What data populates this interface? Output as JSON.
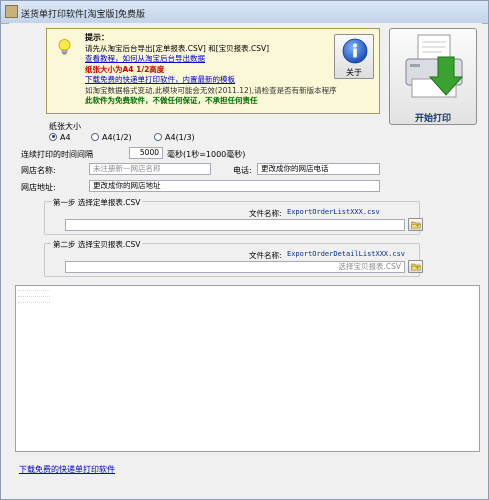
{
  "window": {
    "title": "送货单打印软件[淘宝版]免费版"
  },
  "info": {
    "hint_title": "提示：",
    "line1": "请先从淘宝后台导出[定单报表.CSV] 和[宝贝报表.CSV]",
    "link_tutorial": "查看教程，如何从淘宝后台导出数据",
    "paper_note": "纸张大小为A4 1/2高度",
    "link_download": "下载免费的快递单打印软件，内置最新的模板",
    "format_note": "如淘宝数据格式变动,此模块可能会无效(2011.12),请检查是否有新版本程序",
    "free_note": "此软件为免费软件，不做任何保证，不承担任何责任"
  },
  "buttons": {
    "about": "关于",
    "print": "开始打印"
  },
  "paper": {
    "title": "纸张大小",
    "options": [
      {
        "label": "A4",
        "selected": true
      },
      {
        "label": "A4(1/2)",
        "selected": false
      },
      {
        "label": "A4(1/3)",
        "selected": false
      }
    ]
  },
  "interval": {
    "label": "连续打印的时间间隔",
    "value": "5000",
    "unit": "毫秒(1秒=1000毫秒)"
  },
  "shop": {
    "name_label": "网店名称:",
    "name_placeholder": "未注册新一网店名称",
    "phone_label": "电话:",
    "phone_value": "更改成你的网店电话",
    "address_label": "网店地址:",
    "address_value": "更改成你的网店地址"
  },
  "step1": {
    "title": "第一步 选择定单报表.CSV",
    "file_label": "文件名称:",
    "file_name": "ExportOrderListXXX.csv",
    "path_value": ""
  },
  "step2": {
    "title": "第二步 选择宝贝报表.CSV",
    "file_label": "文件名称:",
    "file_name": "ExportOrderDetailListXXX.csv",
    "path_placeholder": "选择宝贝报表.CSV"
  },
  "footer": {
    "link": "下载免费的快递单打印软件"
  },
  "colors": {
    "info_bg": "#fbf8d8",
    "link": "#0000cc",
    "warning": "#cc0000",
    "free": "#007000",
    "print_arrow": "#3aa330"
  }
}
